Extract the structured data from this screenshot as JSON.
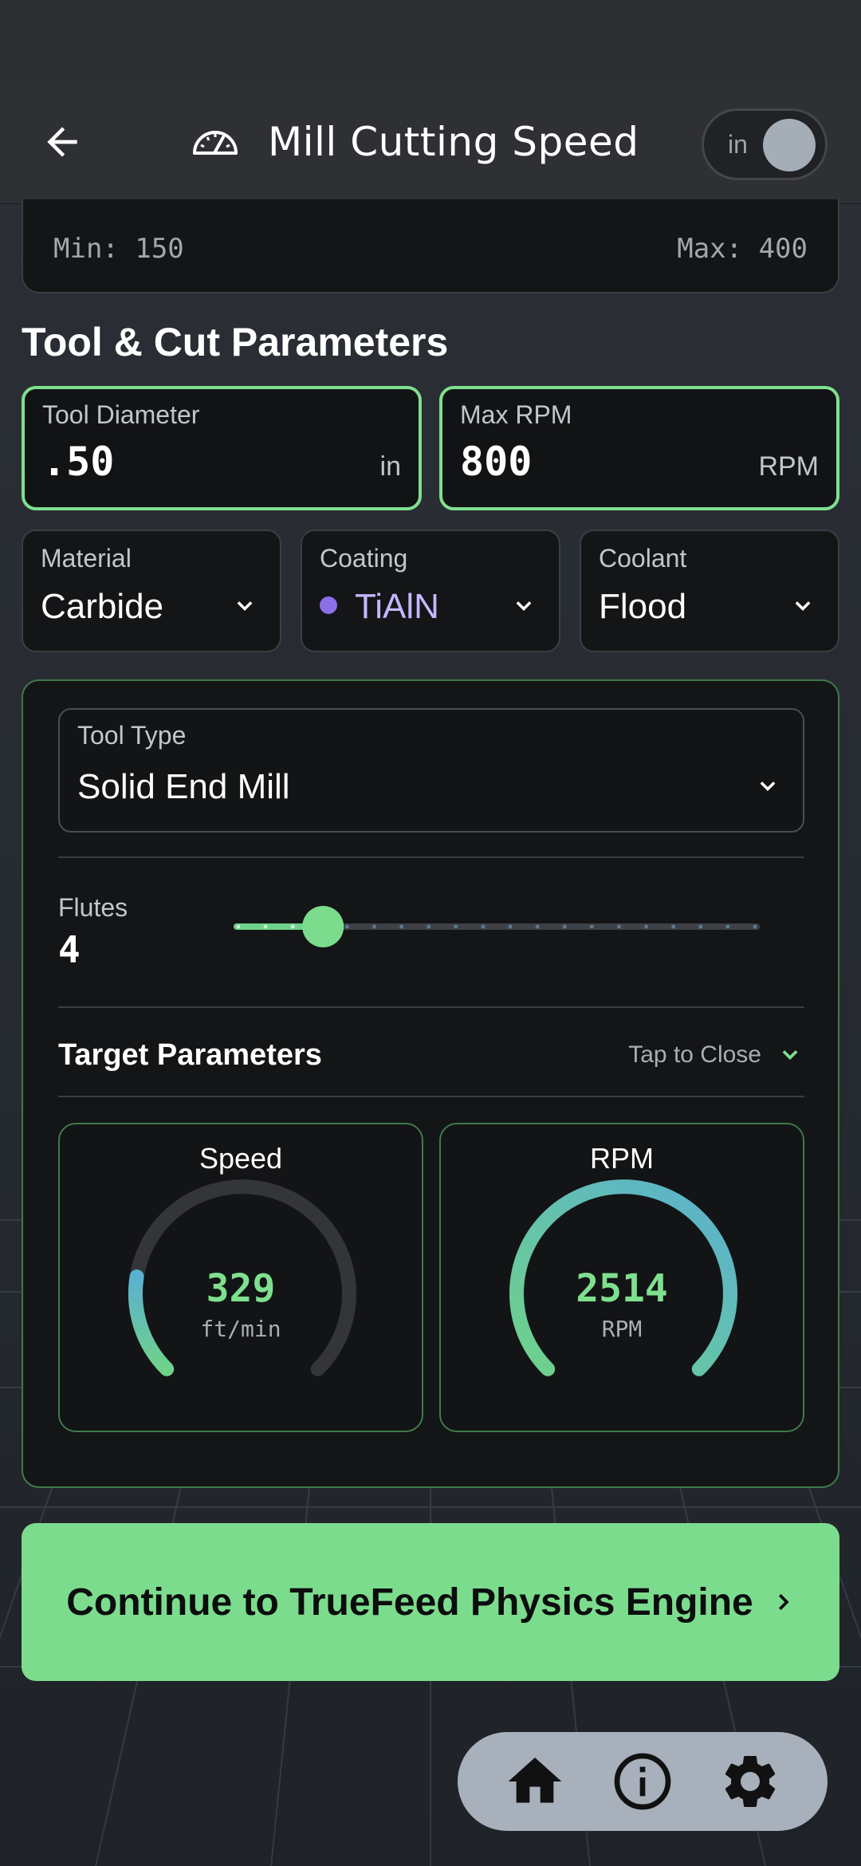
{
  "header": {
    "title": "Mill Cutting Speed",
    "unit_toggle_label": "in"
  },
  "range": {
    "min": "Min: 150",
    "max": "Max: 400"
  },
  "section": {
    "title": "Tool & Cut Parameters"
  },
  "tool_diameter": {
    "label": "Tool Diameter",
    "value": ".50",
    "unit": "in"
  },
  "max_rpm": {
    "label": "Max RPM",
    "value": "800",
    "unit": "RPM"
  },
  "material": {
    "label": "Material",
    "value": "Carbide"
  },
  "coating": {
    "label": "Coating",
    "value": "TiAlN",
    "color": "#8b6fe6"
  },
  "coolant": {
    "label": "Coolant",
    "value": "Flood"
  },
  "tool_type": {
    "label": "Tool Type",
    "value": "Solid End Mill"
  },
  "flutes": {
    "label": "Flutes",
    "value": "4",
    "slider_fraction": 0.17
  },
  "target": {
    "title": "Target Parameters",
    "toggle_label": "Tap to Close"
  },
  "gauges": {
    "speed": {
      "title": "Speed",
      "value": "329",
      "unit": "ft/min",
      "fill_fraction": 0.2
    },
    "rpm": {
      "title": "RPM",
      "value": "2514",
      "unit": "RPM",
      "fill_fraction": 1.0
    }
  },
  "cta": {
    "label": "Continue to TrueFeed Physics Engine"
  },
  "colors": {
    "accent": "#7cdc8d",
    "gauge_gradient_start": "#6fd28a",
    "gauge_gradient_end": "#5ab0d0"
  },
  "nav": {
    "icons": [
      "home-icon",
      "info-icon",
      "settings-icon"
    ]
  }
}
